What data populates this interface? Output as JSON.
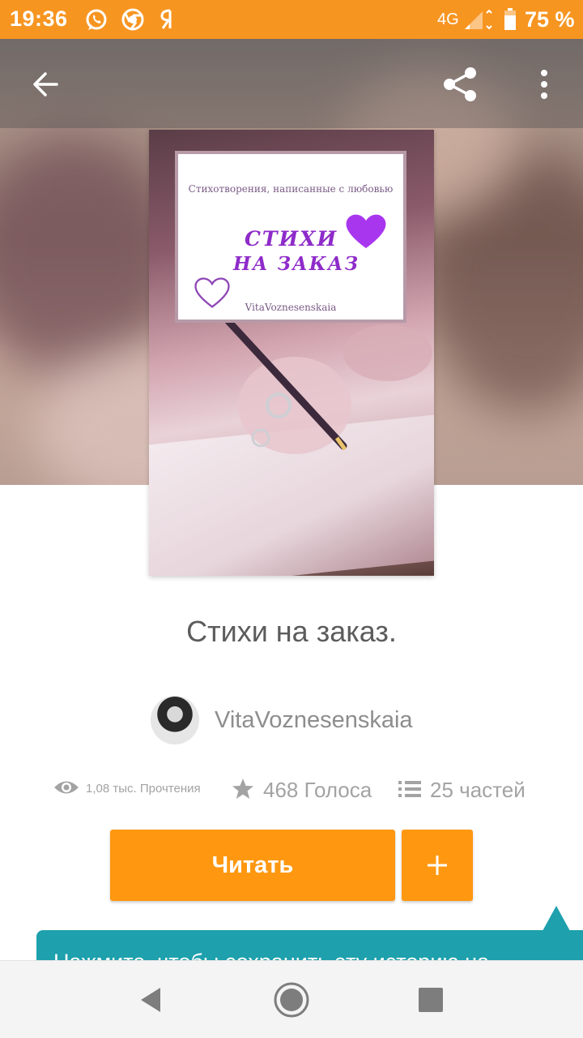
{
  "status_bar": {
    "time": "19:36",
    "notification_icons": [
      "whatsapp-icon",
      "chrome-icon",
      "yandex-icon"
    ],
    "network": "4G",
    "battery": "75 %",
    "color": "#f79521"
  },
  "header": {
    "back_icon": "arrow-left-icon",
    "share_icon": "share-icon",
    "menu_icon": "more-vertical-icon"
  },
  "cover": {
    "subtitle": "Стихотворения, написанные с любовью",
    "title_line1": "СТИХИ",
    "title_line2": "НА ЗАКАЗ",
    "author": "VitaVoznesenskaia"
  },
  "book": {
    "title": "Стихи на заказ.",
    "author": "VitaVoznesenskaia"
  },
  "stats": {
    "reads": "1,08 тыс. Прочтения",
    "votes": "468 Голоса",
    "parts": "25 частей"
  },
  "actions": {
    "read_label": "Читать",
    "add_label": "+"
  },
  "tooltip": {
    "text": "Нажмите, чтобы сохранить эту историю на"
  },
  "nav": {
    "back": "back-triangle-icon",
    "home": "home-circle-icon",
    "recents": "recents-square-icon"
  },
  "colors": {
    "accent": "#ff9810",
    "tooltip": "#1ea0ad",
    "cover_title": "#8e2bc9"
  }
}
